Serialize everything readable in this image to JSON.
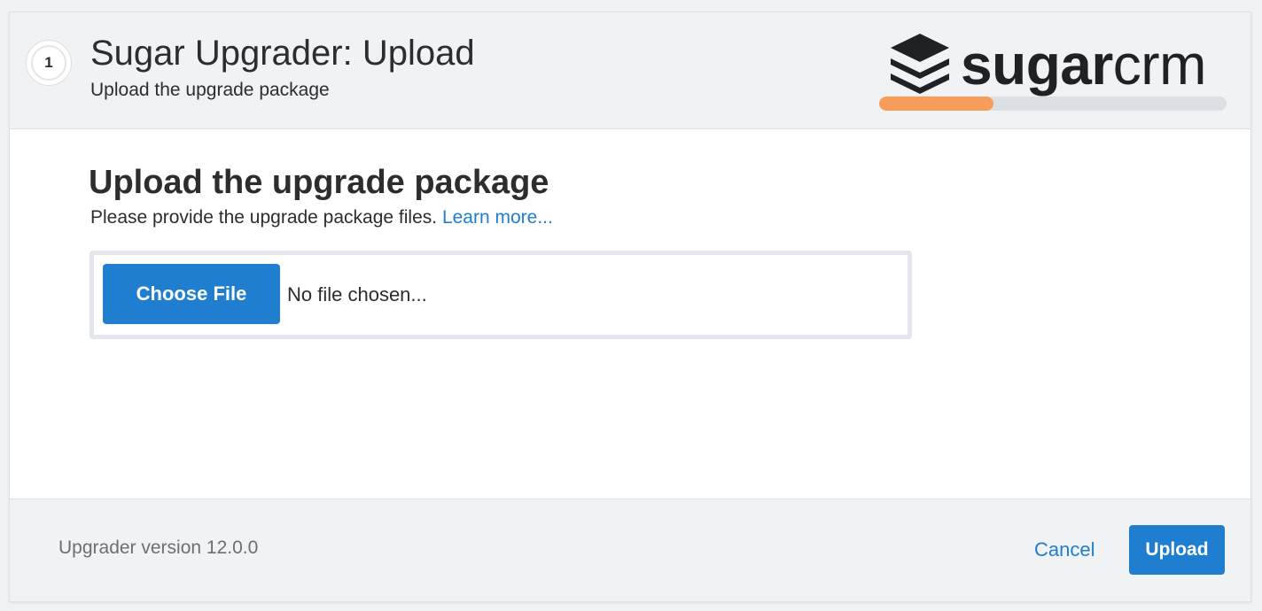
{
  "header": {
    "step_number": "1",
    "title": "Sugar Upgrader: Upload",
    "subtitle": "Upload the upgrade package",
    "logo_text_bold": "sugar",
    "logo_text_light": "crm",
    "progress_fraction": 0.33
  },
  "main": {
    "section_title": "Upload the upgrade package",
    "description": "Please provide the upgrade package files. ",
    "learn_more_label": "Learn more...",
    "choose_file_label": "Choose File",
    "file_status": "No file chosen..."
  },
  "footer": {
    "version": "Upgrader version 12.0.0",
    "cancel_label": "Cancel",
    "upload_label": "Upload"
  },
  "colors": {
    "accent": "#1f7ed0",
    "progress": "#f79d5c",
    "header_bg": "#f1f2f4"
  },
  "icons": {
    "logo": "stacked-layers-icon"
  }
}
